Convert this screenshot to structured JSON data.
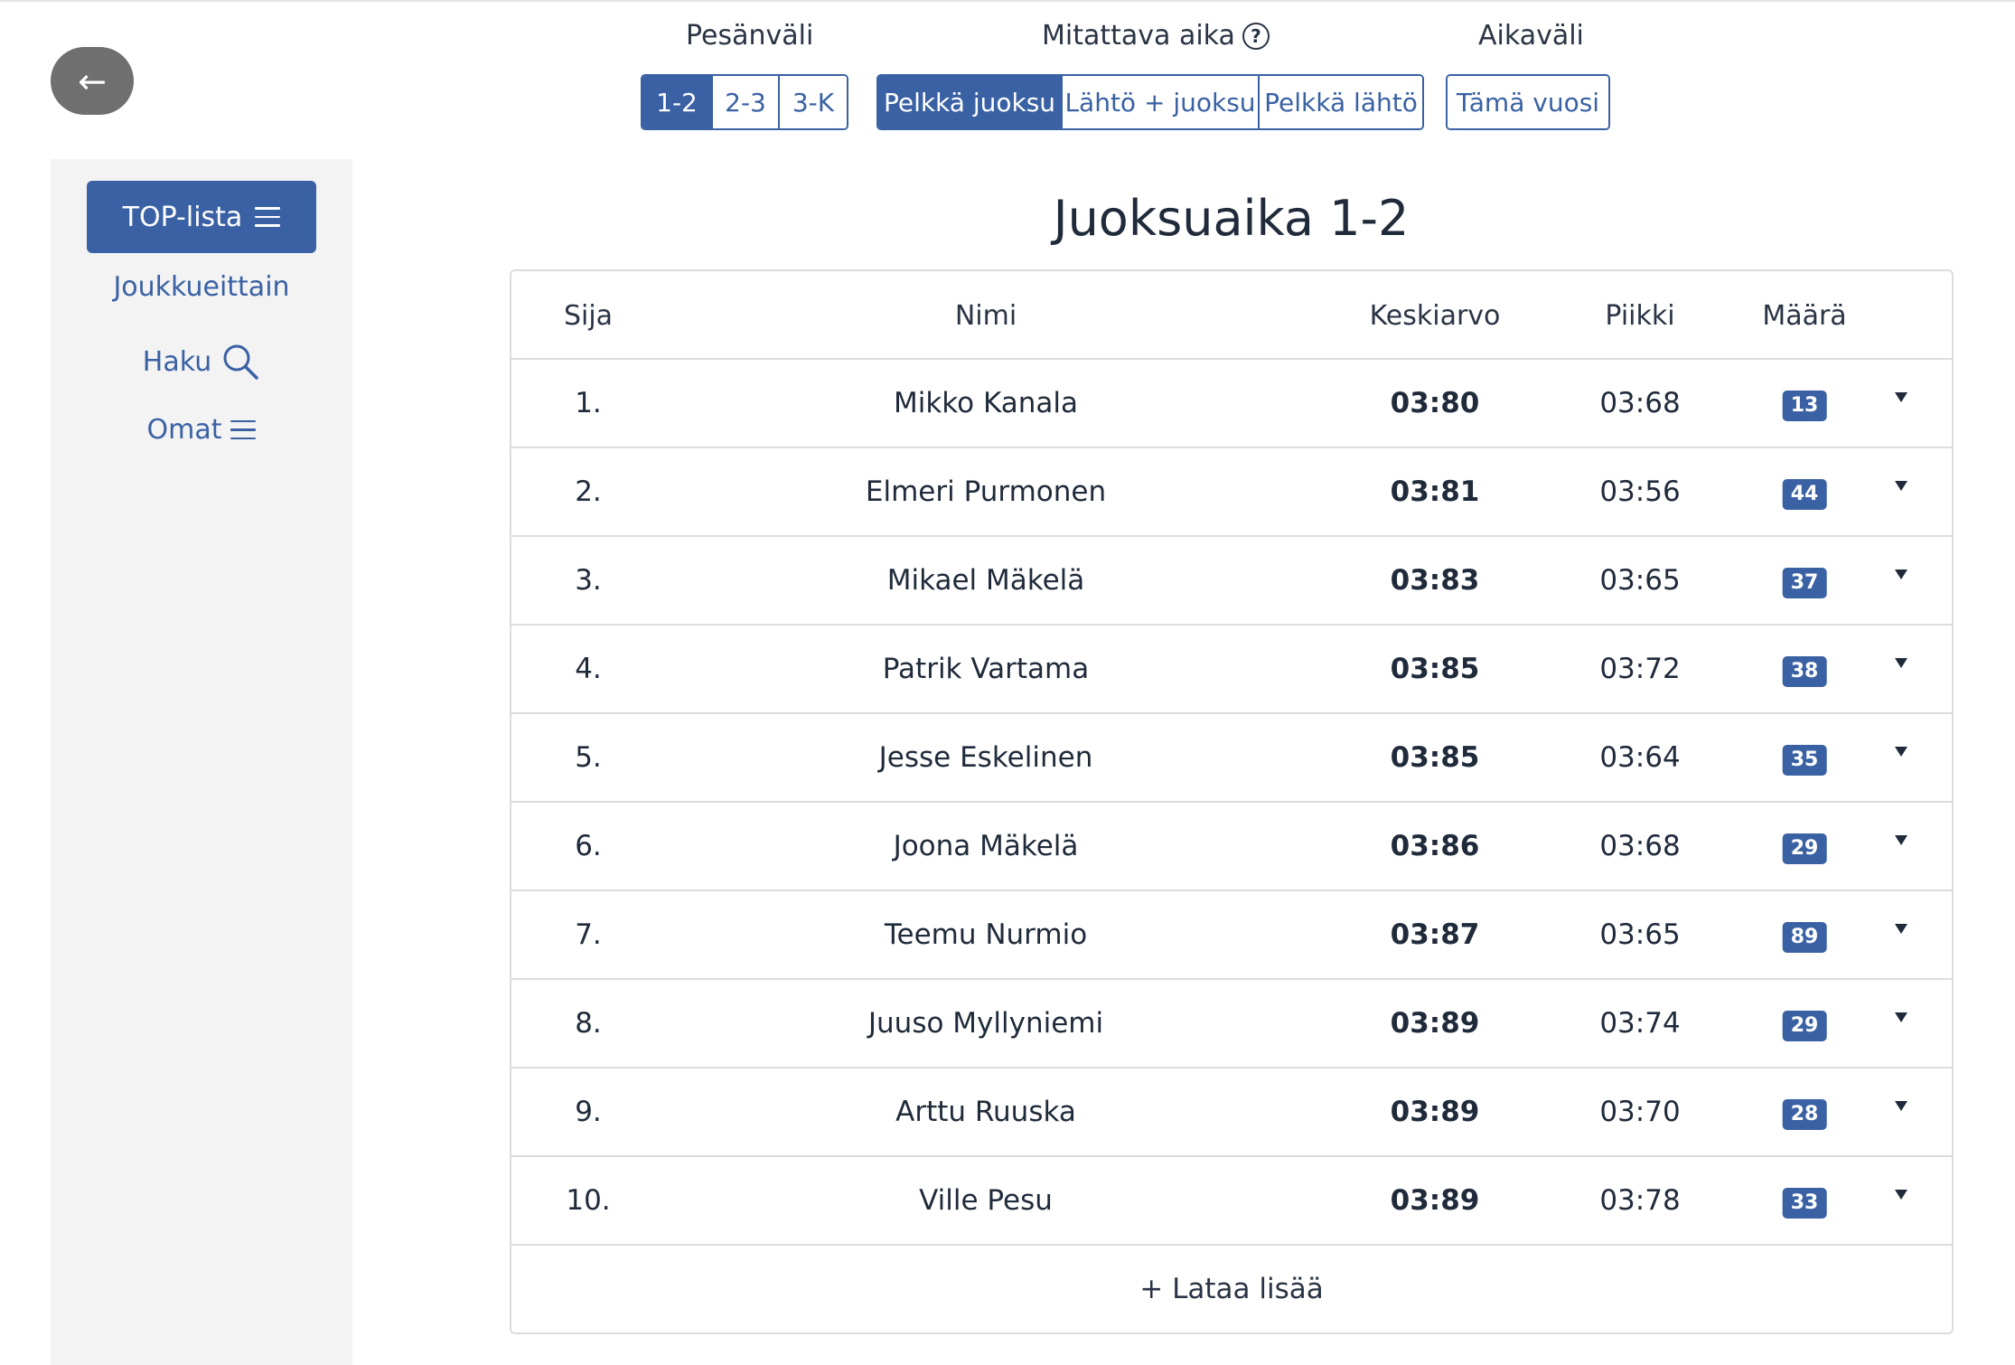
{
  "back": {
    "icon": "arrow-left-icon",
    "glyph": "←"
  },
  "sidebar": {
    "primary_label": "TOP-lista",
    "items": [
      {
        "label": "Joukkueittain"
      },
      {
        "label": "Haku",
        "icon": "search-icon"
      },
      {
        "label": "Omat",
        "icon": "menu-icon"
      }
    ]
  },
  "filters": {
    "pesavali": {
      "label": "Pesänväli",
      "options": [
        "1-2",
        "2-3",
        "3-K"
      ],
      "selected": "1-2"
    },
    "mitattava": {
      "label": "Mitattava aika",
      "help": "?",
      "options": [
        "Pelkkä juoksu",
        "Lähtö + juoksu",
        "Pelkkä lähtö"
      ],
      "selected": "Pelkkä juoksu"
    },
    "aikavali": {
      "label": "Aikaväli",
      "options": [
        "Tämä vuosi"
      ]
    }
  },
  "title": "Juoksuaika 1-2",
  "table": {
    "headers": [
      "Sija",
      "Nimi",
      "Keskiarvo",
      "Piikki",
      "Määrä"
    ],
    "rows": [
      {
        "rank": "1.",
        "name": "Mikko Kanala",
        "avg": "03:80",
        "peak": "03:68",
        "count": "13"
      },
      {
        "rank": "2.",
        "name": "Elmeri Purmonen",
        "avg": "03:81",
        "peak": "03:56",
        "count": "44"
      },
      {
        "rank": "3.",
        "name": "Mikael Mäkelä",
        "avg": "03:83",
        "peak": "03:65",
        "count": "37"
      },
      {
        "rank": "4.",
        "name": "Patrik Vartama",
        "avg": "03:85",
        "peak": "03:72",
        "count": "38"
      },
      {
        "rank": "5.",
        "name": "Jesse Eskelinen",
        "avg": "03:85",
        "peak": "03:64",
        "count": "35"
      },
      {
        "rank": "6.",
        "name": "Joona Mäkelä",
        "avg": "03:86",
        "peak": "03:68",
        "count": "29"
      },
      {
        "rank": "7.",
        "name": "Teemu Nurmio",
        "avg": "03:87",
        "peak": "03:65",
        "count": "89"
      },
      {
        "rank": "8.",
        "name": "Juuso Myllyniemi",
        "avg": "03:89",
        "peak": "03:74",
        "count": "29"
      },
      {
        "rank": "9.",
        "name": "Arttu Ruuska",
        "avg": "03:89",
        "peak": "03:70",
        "count": "28"
      },
      {
        "rank": "10.",
        "name": "Ville Pesu",
        "avg": "03:89",
        "peak": "03:78",
        "count": "33"
      }
    ],
    "load_more": "+ Lataa lisää"
  },
  "colors": {
    "accent": "#3a61a4",
    "back_button": "#6f6f6f",
    "sidebar_bg": "#f3f3f3"
  }
}
